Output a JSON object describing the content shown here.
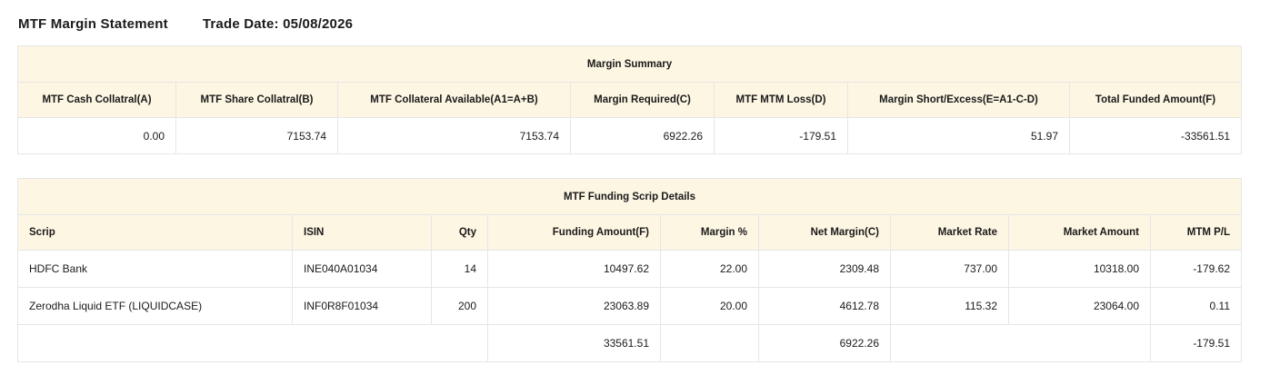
{
  "header": {
    "title": "MTF Margin Statement",
    "trade_date": "Trade Date: 05/08/2026"
  },
  "summary": {
    "title": "Margin Summary",
    "columns": [
      "MTF Cash Collatral(A)",
      "MTF Share Collatral(B)",
      "MTF Collateral Available(A1=A+B)",
      "Margin Required(C)",
      "MTF MTM Loss(D)",
      "Margin Short/Excess(E=A1-C-D)",
      "Total Funded Amount(F)"
    ],
    "values": [
      "0.00",
      "7153.74",
      "7153.74",
      "6922.26",
      "-179.51",
      "51.97",
      "-33561.51"
    ]
  },
  "scrip": {
    "title": "MTF Funding Scrip Details",
    "columns": [
      "Scrip",
      "ISIN",
      "Qty",
      "Funding Amount(F)",
      "Margin %",
      "Net Margin(C)",
      "Market Rate",
      "Market Amount",
      "MTM P/L"
    ],
    "rows": [
      [
        "HDFC Bank",
        "INE040A01034",
        "14",
        "10497.62",
        "22.00",
        "2309.48",
        "737.00",
        "10318.00",
        "-179.62"
      ],
      [
        "Zerodha Liquid ETF (LIQUIDCASE)",
        "INF0R8F01034",
        "200",
        "23063.89",
        "20.00",
        "4612.78",
        "115.32",
        "23064.00",
        "0.11"
      ]
    ],
    "totals": {
      "funding_amount": "33561.51",
      "net_margin": "6922.26",
      "mtm_pl": "-179.51"
    }
  }
}
